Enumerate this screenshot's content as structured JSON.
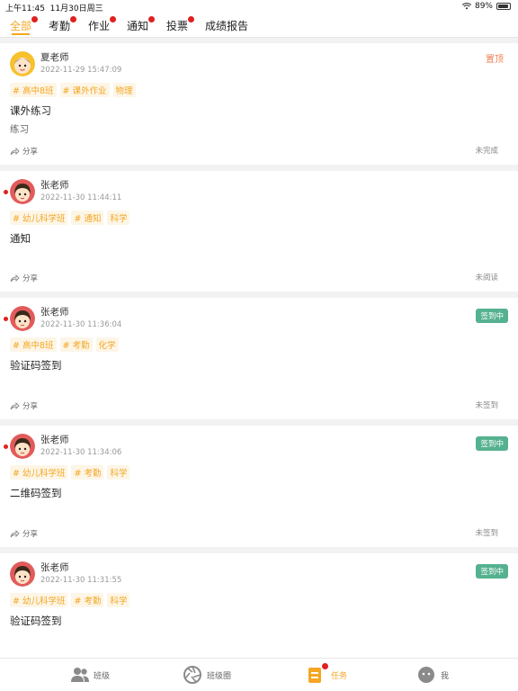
{
  "status_bar": {
    "time": "上午11:45",
    "date": "11月30日周三",
    "battery": "89%",
    "battery_level": 0.89
  },
  "tabs": [
    {
      "label": "全部",
      "active": true,
      "badge": true
    },
    {
      "label": "考勤",
      "active": false,
      "badge": true
    },
    {
      "label": "作业",
      "active": false,
      "badge": true
    },
    {
      "label": "通知",
      "active": false,
      "badge": true
    },
    {
      "label": "投票",
      "active": false,
      "badge": true
    },
    {
      "label": "成绩报告",
      "active": false,
      "badge": false
    }
  ],
  "cards": [
    {
      "teacher": "夏老师",
      "time": "2022-11-29 15:47:09",
      "tags": [
        "# 高中8班",
        "# 课外作业",
        "物理"
      ],
      "title": "课外练习",
      "body": "练习",
      "share": "分享",
      "status": "未完成",
      "pinned": "置顶",
      "badge": "",
      "unread": false
    },
    {
      "teacher": "张老师",
      "time": "2022-11-30 11:44:11",
      "tags": [
        "# 幼儿科学班",
        "# 通知",
        "科学"
      ],
      "title": "通知",
      "body": "",
      "share": "分享",
      "status": "未阅读",
      "pinned": "",
      "badge": "",
      "unread": true
    },
    {
      "teacher": "张老师",
      "time": "2022-11-30 11:36:04",
      "tags": [
        "# 高中8班",
        "# 考勤",
        "化学"
      ],
      "title": "验证码签到",
      "body": "",
      "share": "分享",
      "status": "未签到",
      "pinned": "",
      "badge": "签到中",
      "unread": true
    },
    {
      "teacher": "张老师",
      "time": "2022-11-30 11:34:06",
      "tags": [
        "# 幼儿科学班",
        "# 考勤",
        "科学"
      ],
      "title": "二维码签到",
      "body": "",
      "share": "分享",
      "status": "未签到",
      "pinned": "",
      "badge": "签到中",
      "unread": true
    },
    {
      "teacher": "张老师",
      "time": "2022-11-30 11:31:55",
      "tags": [
        "# 幼儿科学班",
        "# 考勤",
        "科学"
      ],
      "title": "验证码签到",
      "body": "",
      "share": "分享",
      "status": "",
      "pinned": "",
      "badge": "签到中",
      "unread": false
    }
  ],
  "bottom_nav": [
    {
      "label": "班级",
      "icon": "people-icon",
      "active": false,
      "badge": false
    },
    {
      "label": "班级圈",
      "icon": "shutter-icon",
      "active": false,
      "badge": false
    },
    {
      "label": "任务",
      "icon": "task-icon",
      "active": true,
      "badge": true
    },
    {
      "label": "我",
      "icon": "profile-icon",
      "active": false,
      "badge": false
    }
  ],
  "colors": {
    "accent": "#f5a623",
    "badge_green": "#55b18f",
    "pinned": "#f07c4f",
    "dot_red": "#e02020"
  }
}
